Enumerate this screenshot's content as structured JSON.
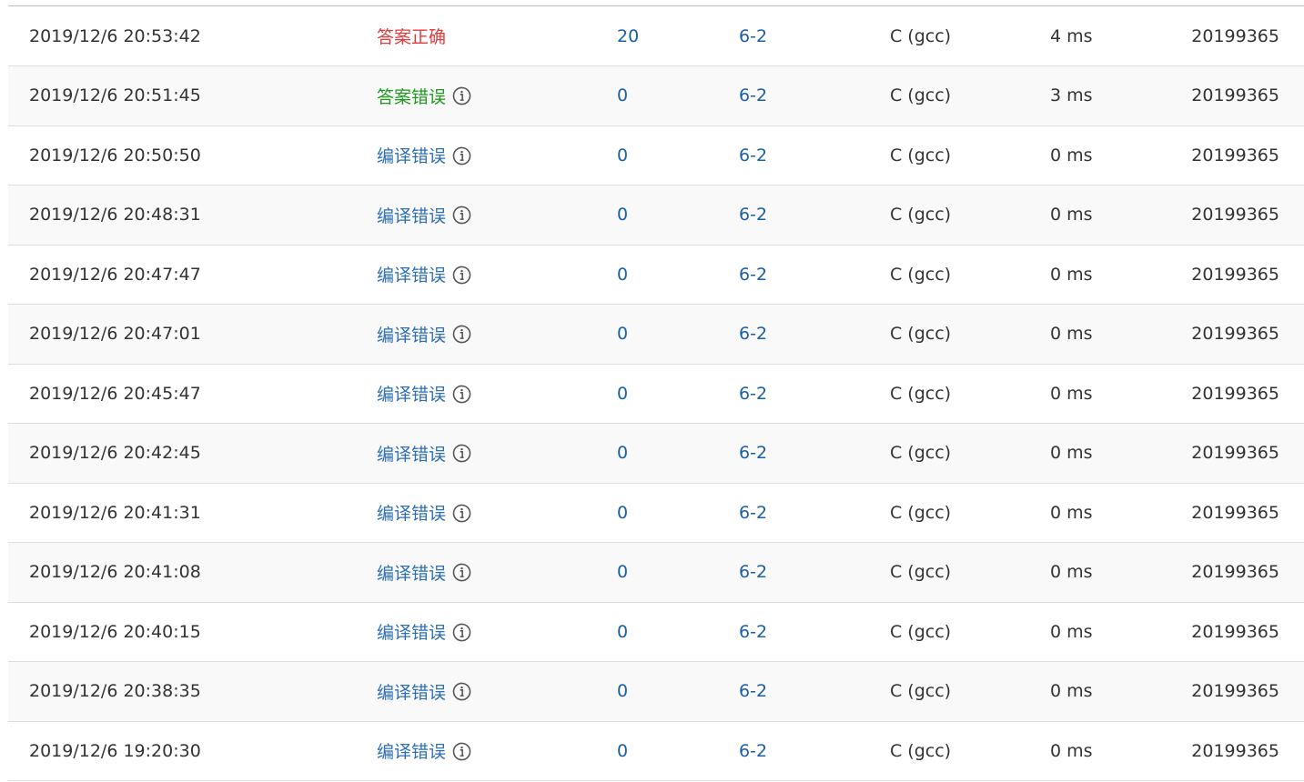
{
  "colors": {
    "accepted": "#e23b3b",
    "wrong_answer": "#1e9a1e",
    "compile_error": "#2e6fb5",
    "link": "#1b5fa8",
    "text": "#333333",
    "row_alt": "#f9f9f9"
  },
  "info_icon": "info-circle-icon",
  "rows": [
    {
      "time": "2019/12/6 20:53:42",
      "status": "答案正确",
      "status_type": "accepted",
      "score": "20",
      "problem": "6-2",
      "language": "C (gcc)",
      "run_time": "4 ms",
      "user": "20199365"
    },
    {
      "time": "2019/12/6 20:51:45",
      "status": "答案错误",
      "status_type": "wrong",
      "score": "0",
      "problem": "6-2",
      "language": "C (gcc)",
      "run_time": "3 ms",
      "user": "20199365"
    },
    {
      "time": "2019/12/6 20:50:50",
      "status": "编译错误",
      "status_type": "compile",
      "score": "0",
      "problem": "6-2",
      "language": "C (gcc)",
      "run_time": "0 ms",
      "user": "20199365"
    },
    {
      "time": "2019/12/6 20:48:31",
      "status": "编译错误",
      "status_type": "compile",
      "score": "0",
      "problem": "6-2",
      "language": "C (gcc)",
      "run_time": "0 ms",
      "user": "20199365"
    },
    {
      "time": "2019/12/6 20:47:47",
      "status": "编译错误",
      "status_type": "compile",
      "score": "0",
      "problem": "6-2",
      "language": "C (gcc)",
      "run_time": "0 ms",
      "user": "20199365"
    },
    {
      "time": "2019/12/6 20:47:01",
      "status": "编译错误",
      "status_type": "compile",
      "score": "0",
      "problem": "6-2",
      "language": "C (gcc)",
      "run_time": "0 ms",
      "user": "20199365"
    },
    {
      "time": "2019/12/6 20:45:47",
      "status": "编译错误",
      "status_type": "compile",
      "score": "0",
      "problem": "6-2",
      "language": "C (gcc)",
      "run_time": "0 ms",
      "user": "20199365"
    },
    {
      "time": "2019/12/6 20:42:45",
      "status": "编译错误",
      "status_type": "compile",
      "score": "0",
      "problem": "6-2",
      "language": "C (gcc)",
      "run_time": "0 ms",
      "user": "20199365"
    },
    {
      "time": "2019/12/6 20:41:31",
      "status": "编译错误",
      "status_type": "compile",
      "score": "0",
      "problem": "6-2",
      "language": "C (gcc)",
      "run_time": "0 ms",
      "user": "20199365"
    },
    {
      "time": "2019/12/6 20:41:08",
      "status": "编译错误",
      "status_type": "compile",
      "score": "0",
      "problem": "6-2",
      "language": "C (gcc)",
      "run_time": "0 ms",
      "user": "20199365"
    },
    {
      "time": "2019/12/6 20:40:15",
      "status": "编译错误",
      "status_type": "compile",
      "score": "0",
      "problem": "6-2",
      "language": "C (gcc)",
      "run_time": "0 ms",
      "user": "20199365"
    },
    {
      "time": "2019/12/6 20:38:35",
      "status": "编译错误",
      "status_type": "compile",
      "score": "0",
      "problem": "6-2",
      "language": "C (gcc)",
      "run_time": "0 ms",
      "user": "20199365"
    },
    {
      "time": "2019/12/6 19:20:30",
      "status": "编译错误",
      "status_type": "compile",
      "score": "0",
      "problem": "6-2",
      "language": "C (gcc)",
      "run_time": "0 ms",
      "user": "20199365"
    }
  ]
}
